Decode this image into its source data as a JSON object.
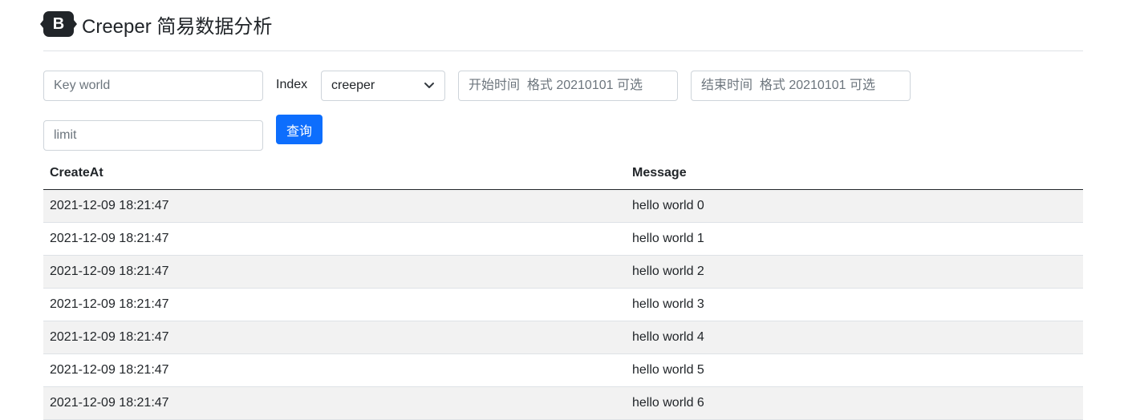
{
  "header": {
    "logo_letter": "B",
    "title": "Creeper 简易数据分析"
  },
  "search": {
    "keyword_placeholder": "Key world",
    "index_label": "Index",
    "index_selected": "creeper",
    "start_placeholder": "开始时间  格式 20210101 可选",
    "end_placeholder": "结束时间  格式 20210101 可选",
    "limit_placeholder": "limit",
    "query_label": "查询"
  },
  "table": {
    "headers": [
      "CreateAt",
      "Message"
    ],
    "rows": [
      [
        "2021-12-09 18:21:47",
        "hello world 0"
      ],
      [
        "2021-12-09 18:21:47",
        "hello world 1"
      ],
      [
        "2021-12-09 18:21:47",
        "hello world 2"
      ],
      [
        "2021-12-09 18:21:47",
        "hello world 3"
      ],
      [
        "2021-12-09 18:21:47",
        "hello world 4"
      ],
      [
        "2021-12-09 18:21:47",
        "hello world 5"
      ],
      [
        "2021-12-09 18:21:47",
        "hello world 6"
      ]
    ]
  },
  "colors": {
    "primary": "#0d6efd",
    "stripe": "#f2f2f2",
    "text": "#212529"
  }
}
